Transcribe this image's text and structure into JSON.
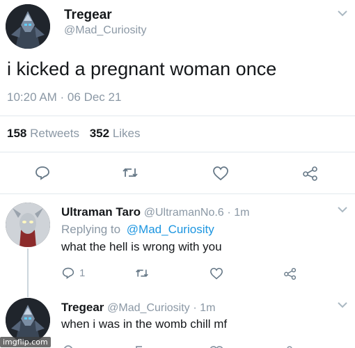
{
  "main_tweet": {
    "display_name": "Tregear",
    "handle": "@Mad_Curiosity",
    "text": "i kicked a pregnant woman once",
    "timestamp": "10:20 AM · 06 Dec 21",
    "retweets_count": "158",
    "retweets_label": "Retweets",
    "likes_count": "352",
    "likes_label": "Likes"
  },
  "reply_1": {
    "display_name": "Ultraman Taro",
    "handle": "@UltramanNo.6",
    "time": "· 1m",
    "replying_to_label": "Replying to",
    "replying_to_handle": "@Mad_Curiosity",
    "text": "what the hell is wrong with you",
    "reply_count": "1"
  },
  "reply_2": {
    "display_name": "Tregear",
    "handle": "@Mad_Curiosity",
    "time": "· 1m",
    "text": "when i was in the womb chill mf"
  },
  "watermark": "imgflip.com",
  "icons": [
    "chevron-down-icon",
    "reply-icon",
    "retweet-icon",
    "like-icon",
    "share-icon"
  ],
  "colors": {
    "text": "#14171a",
    "muted": "#8b98a5",
    "link": "#1b95e0",
    "divider": "#e1e8ed"
  }
}
